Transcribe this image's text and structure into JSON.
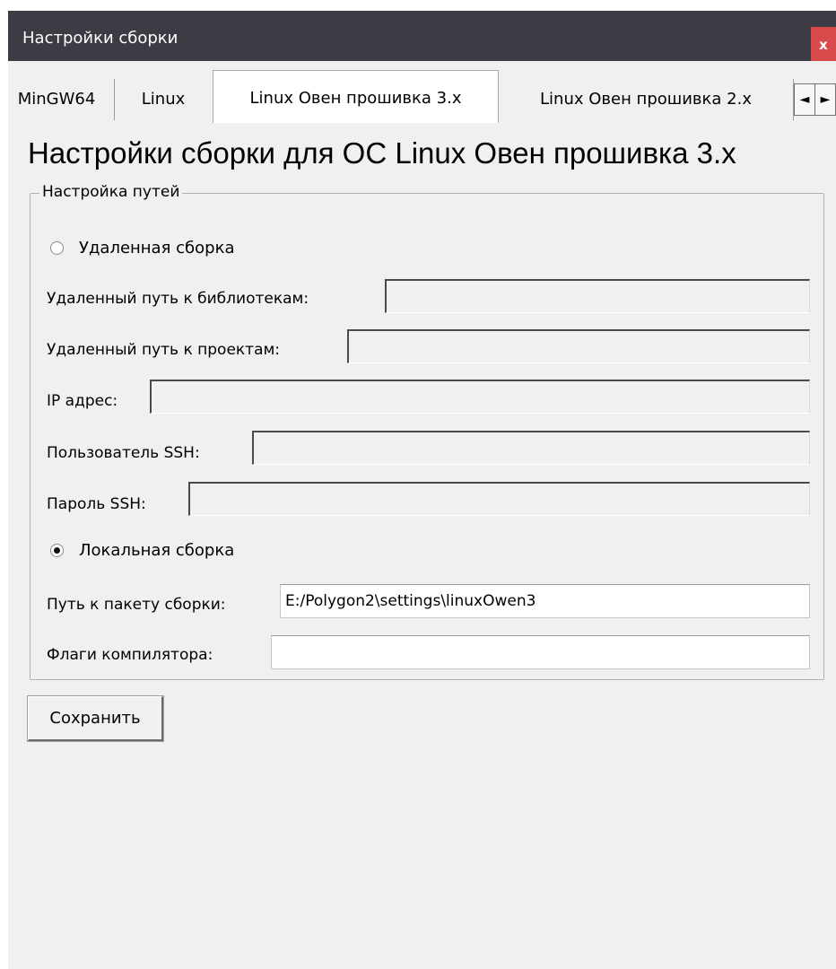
{
  "window": {
    "title": "Настройки сборки",
    "close_label": "x"
  },
  "tabs": [
    {
      "label": "MinGW64"
    },
    {
      "label": "Linux"
    },
    {
      "label": "Linux Овен прошивка 3.x",
      "active": true
    },
    {
      "label": "Linux Овен прошивка 2.x"
    }
  ],
  "tab_scroll": {
    "left": "◄",
    "right": "►"
  },
  "page": {
    "heading": "Настройки сборки для ОС Linux Овен прошивка 3.x"
  },
  "paths": {
    "legend": "Настройка путей",
    "remote_build_label": "Удаленная сборка",
    "remote_build_selected": false,
    "remote_lib_path_label": "Удаленный путь к библиотекам:",
    "remote_lib_path_value": "",
    "remote_projects_path_label": "Удаленный путь к проектам:",
    "remote_projects_path_value": "",
    "ip_label": "IP адрес:",
    "ip_value": "",
    "ssh_user_label": "Пользователь SSH:",
    "ssh_user_value": "",
    "ssh_password_label": "Пароль SSH:",
    "ssh_password_value": "",
    "local_build_label": "Локальная сборка",
    "local_build_selected": true,
    "package_path_label": "Путь к пакету сборки:",
    "package_path_value": "E:/Polygon2\\settings\\linuxOwen3",
    "compiler_flags_label": "Флаги компилятора:",
    "compiler_flags_value": ""
  },
  "actions": {
    "save_label": "Сохранить"
  }
}
